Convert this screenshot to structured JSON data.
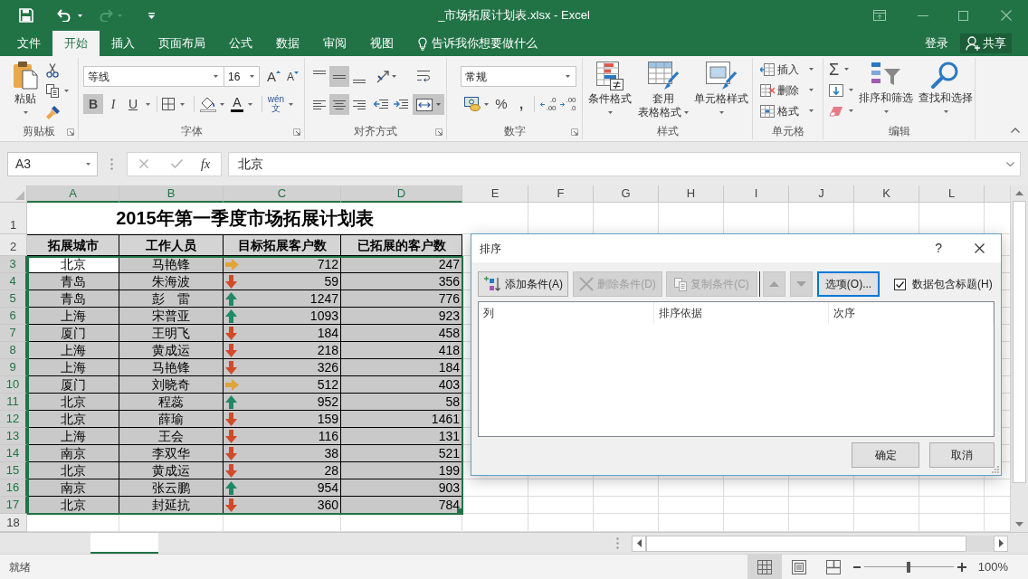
{
  "title_bar": {
    "title": "_市场拓展计划表.xlsx - Excel"
  },
  "menu_tabs": [
    {
      "label": "文件",
      "selected": false
    },
    {
      "label": "开始",
      "selected": true
    },
    {
      "label": "插入",
      "selected": false
    },
    {
      "label": "页面布局",
      "selected": false
    },
    {
      "label": "公式",
      "selected": false
    },
    {
      "label": "数据",
      "selected": false
    },
    {
      "label": "审阅",
      "selected": false
    },
    {
      "label": "视图",
      "selected": false
    }
  ],
  "tell_me": "告诉我你想要做什么",
  "account": {
    "sign_in": "登录",
    "share": "共享"
  },
  "ribbon": {
    "clipboard": {
      "paste": "粘贴",
      "label": "剪贴板"
    },
    "font": {
      "font_name": "等线",
      "font_size": "16",
      "grow": "A",
      "shrink": "A",
      "styles": [
        {
          "text": "B",
          "on": true
        },
        {
          "text": "I",
          "on": false
        },
        {
          "text": "U",
          "on": false
        }
      ],
      "font_color": "A",
      "phonetic": [
        "wén",
        "文"
      ],
      "label": "字体"
    },
    "alignment": {
      "vertical": [
        {
          "kind": "top",
          "on": false
        },
        {
          "kind": "middle",
          "on": true
        },
        {
          "kind": "bottom",
          "on": false
        }
      ],
      "horizontal": [
        {
          "kind": "left",
          "on": false
        },
        {
          "kind": "center",
          "on": true
        },
        {
          "kind": "right",
          "on": false
        }
      ],
      "merge_on": true,
      "label": "对齐方式"
    },
    "number": {
      "format": "常规",
      "percent": "%",
      "comma": ",",
      "increase_decimal": [
        ".0",
        ".00"
      ],
      "decrease_decimal": [
        ".00",
        ".0"
      ],
      "label": "数字"
    },
    "styles": {
      "buttons": [
        {
          "kind": "conditional",
          "lines": [
            "条件格式"
          ]
        },
        {
          "kind": "table",
          "lines": [
            "套用",
            "表格格式"
          ]
        },
        {
          "kind": "cell",
          "lines": [
            "单元格样式"
          ]
        }
      ],
      "label": "样式"
    },
    "cells": {
      "buttons": [
        {
          "kind": "insert",
          "label": "插入"
        },
        {
          "kind": "delete",
          "label": "删除"
        },
        {
          "kind": "format",
          "label": "格式"
        }
      ],
      "label": "单元格"
    },
    "editing": {
      "sum": "Σ",
      "buttons": [
        {
          "kind": "sort",
          "label": "排序和筛选"
        },
        {
          "kind": "find",
          "label": "查找和选择"
        }
      ],
      "label": "编辑"
    }
  },
  "formula_bar": {
    "name_box": "A3",
    "fx": "fx",
    "value": "北京"
  },
  "sheet": {
    "columns": [
      {
        "label": "A",
        "selected": true
      },
      {
        "label": "B",
        "selected": true
      },
      {
        "label": "C",
        "selected": true
      },
      {
        "label": "D",
        "selected": true
      },
      {
        "label": "E",
        "selected": false
      },
      {
        "label": "F",
        "selected": false
      },
      {
        "label": "G",
        "selected": false
      },
      {
        "label": "H",
        "selected": false
      },
      {
        "label": "I",
        "selected": false
      },
      {
        "label": "J",
        "selected": false
      },
      {
        "label": "K",
        "selected": false
      },
      {
        "label": "L",
        "selected": false
      }
    ],
    "row_numbers": [
      {
        "label": "1",
        "selected": false
      },
      {
        "label": "2",
        "selected": false
      },
      {
        "label": "3",
        "selected": true
      },
      {
        "label": "4",
        "selected": true
      },
      {
        "label": "5",
        "selected": true
      },
      {
        "label": "6",
        "selected": true
      },
      {
        "label": "7",
        "selected": true
      },
      {
        "label": "8",
        "selected": true
      },
      {
        "label": "9",
        "selected": true
      },
      {
        "label": "10",
        "selected": true
      },
      {
        "label": "11",
        "selected": true
      },
      {
        "label": "12",
        "selected": true
      },
      {
        "label": "13",
        "selected": true
      },
      {
        "label": "14",
        "selected": true
      },
      {
        "label": "15",
        "selected": true
      },
      {
        "label": "16",
        "selected": true
      },
      {
        "label": "17",
        "selected": true
      },
      {
        "label": "18",
        "selected": false
      }
    ],
    "title": "2015年第一季度市场拓展计划表",
    "headers": [
      "拓展城市",
      "工作人员",
      "目标拓展客户数",
      "已拓展的客户数"
    ],
    "records": [
      {
        "city": "北京",
        "person": "马艳锋",
        "arrow": {
          "kind": "right"
        },
        "target": "712",
        "done": "247",
        "selected": true,
        "active": true
      },
      {
        "city": "青岛",
        "person": "朱海波",
        "arrow": {
          "kind": "down"
        },
        "target": "59",
        "done": "356",
        "selected": true,
        "active": false
      },
      {
        "city": "青岛",
        "person": "彭　雷",
        "arrow": {
          "kind": "up"
        },
        "target": "1247",
        "done": "776",
        "selected": true,
        "active": false
      },
      {
        "city": "上海",
        "person": "宋普亚",
        "arrow": {
          "kind": "up"
        },
        "target": "1093",
        "done": "923",
        "selected": true,
        "active": false
      },
      {
        "city": "厦门",
        "person": "王明飞",
        "arrow": {
          "kind": "down"
        },
        "target": "184",
        "done": "458",
        "selected": true,
        "active": false
      },
      {
        "city": "上海",
        "person": "黄成运",
        "arrow": {
          "kind": "down"
        },
        "target": "218",
        "done": "418",
        "selected": true,
        "active": false
      },
      {
        "city": "上海",
        "person": "马艳锋",
        "arrow": {
          "kind": "down"
        },
        "target": "326",
        "done": "184",
        "selected": true,
        "active": false
      },
      {
        "city": "厦门",
        "person": "刘晓奇",
        "arrow": {
          "kind": "right"
        },
        "target": "512",
        "done": "403",
        "selected": true,
        "active": false
      },
      {
        "city": "北京",
        "person": "程蕊",
        "arrow": {
          "kind": "up"
        },
        "target": "952",
        "done": "58",
        "selected": true,
        "active": false
      },
      {
        "city": "北京",
        "person": "薛瑜",
        "arrow": {
          "kind": "down"
        },
        "target": "159",
        "done": "1461",
        "selected": true,
        "active": false
      },
      {
        "city": "上海",
        "person": "王会",
        "arrow": {
          "kind": "down"
        },
        "target": "116",
        "done": "131",
        "selected": true,
        "active": false
      },
      {
        "city": "南京",
        "person": "李双华",
        "arrow": {
          "kind": "down"
        },
        "target": "38",
        "done": "521",
        "selected": true,
        "active": false
      },
      {
        "city": "北京",
        "person": "黄成运",
        "arrow": {
          "kind": "down"
        },
        "target": "28",
        "done": "199",
        "selected": true,
        "active": false
      },
      {
        "city": "南京",
        "person": "张云鹏",
        "arrow": {
          "kind": "up"
        },
        "target": "954",
        "done": "903",
        "selected": true,
        "active": false
      },
      {
        "city": "北京",
        "person": "封延抗",
        "arrow": {
          "kind": "down"
        },
        "target": "360",
        "done": "784",
        "selected": true,
        "active": false
      }
    ]
  },
  "sort_dialog": {
    "title": "排序",
    "help": "?",
    "toolbar": [
      {
        "kind": "add",
        "label": "添加条件(A)",
        "disabled": false,
        "focused": false
      },
      {
        "kind": "delete",
        "label": "删除条件(D)",
        "disabled": true,
        "focused": false
      },
      {
        "kind": "copy",
        "label": "复制条件(C)",
        "disabled": true,
        "focused": false
      },
      {
        "kind": "up",
        "disabled": true,
        "focused": false
      },
      {
        "kind": "down",
        "disabled": true,
        "focused": false
      },
      {
        "kind": "options",
        "label": "选项(O)...",
        "disabled": false,
        "focused": true
      }
    ],
    "has_headers": {
      "label": "数据包含标题(H)",
      "checked": true
    },
    "columns": [
      "列",
      "排序依据",
      "次序"
    ],
    "buttons": [
      "确定",
      "取消"
    ]
  },
  "status_bar": {
    "status": "就绪",
    "views": [
      {
        "kind": "normal",
        "selected": true
      },
      {
        "kind": "page_layout",
        "selected": false
      },
      {
        "kind": "page_break",
        "selected": false
      }
    ],
    "zoom": {
      "level": 0.5,
      "reading": "100%"
    }
  }
}
